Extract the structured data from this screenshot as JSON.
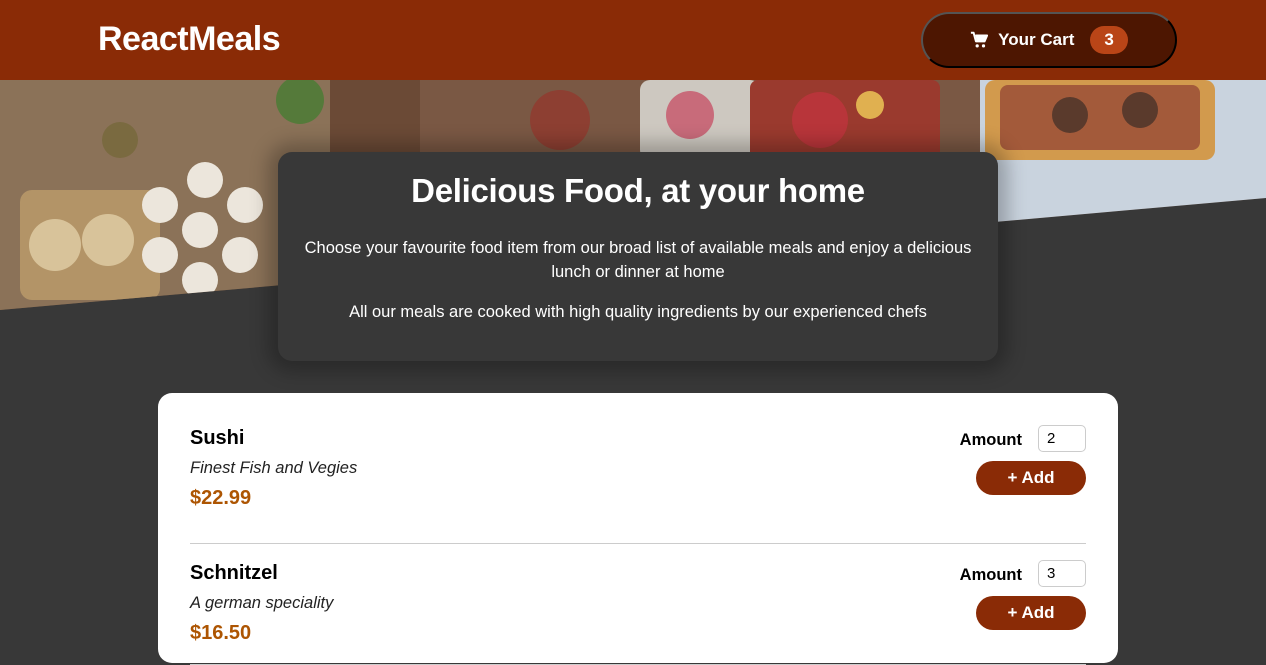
{
  "header": {
    "brand": "ReactMeals",
    "cart_label": "Your Cart",
    "cart_count": "3",
    "cart_icon": "cart-icon"
  },
  "summary": {
    "title": "Delicious Food, at your home",
    "paragraph1": "Choose your favourite food item from our broad list of available meals and enjoy a delicious lunch or dinner at home",
    "paragraph2": "All our meals are cooked with high quality ingredients by our experienced chefs"
  },
  "meals": [
    {
      "name": "Sushi",
      "description": "Finest Fish and Vegies",
      "price": "$22.99",
      "amount_label": "Amount",
      "amount_value": "2",
      "add_label": "+ Add"
    },
    {
      "name": "Schnitzel",
      "description": "A german speciality",
      "price": "$16.50",
      "amount_label": "Amount",
      "amount_value": "3",
      "add_label": "+ Add"
    }
  ],
  "colors": {
    "header_bg": "#8a2b06",
    "cart_bg": "#4d1601",
    "badge_bg": "#b94517",
    "price": "#ad5502",
    "page_bg": "#383838"
  }
}
